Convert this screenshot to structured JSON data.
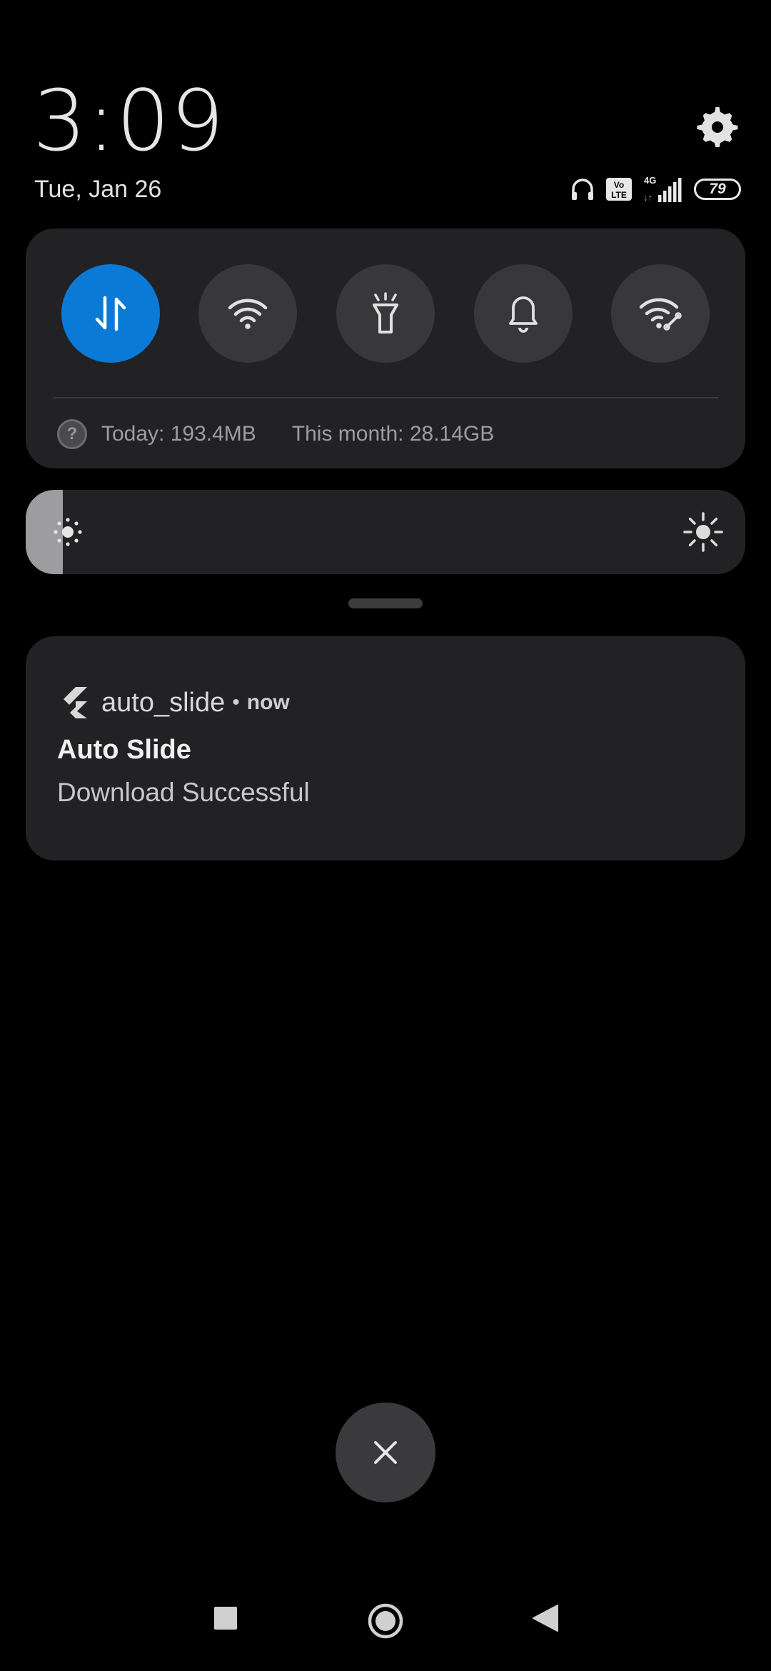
{
  "header": {
    "time": "3:09",
    "date": "Tue, Jan 26",
    "battery_level": "79",
    "network_label": "4G",
    "volte_label": "Vo LTE",
    "icons": [
      "headphones-icon",
      "volte-icon",
      "signal-4g-icon",
      "battery-icon",
      "settings-gear-icon"
    ]
  },
  "quick_settings": {
    "toggles": [
      {
        "name": "mobile-data",
        "icon": "mobile-data-arrows-icon",
        "active": true
      },
      {
        "name": "wifi",
        "icon": "wifi-icon",
        "active": false
      },
      {
        "name": "flashlight",
        "icon": "flashlight-icon",
        "active": false
      },
      {
        "name": "sound",
        "icon": "bell-icon",
        "active": false
      },
      {
        "name": "hotspot",
        "icon": "wifi-hotspot-icon",
        "active": false
      }
    ],
    "data_today": "Today: 193.4MB",
    "data_month": "This month: 28.14GB",
    "help_glyph": "?"
  },
  "brightness": {
    "level_fraction": 0.052
  },
  "notification": {
    "app_name": "auto_slide",
    "separator": "•",
    "time": "now",
    "title": "Auto Slide",
    "text": "Download Successful",
    "app_icon": "flutter-logo-icon"
  },
  "controls": {
    "clear_icon": "close-icon",
    "nav": [
      "recents-square-icon",
      "home-circle-icon",
      "back-triangle-icon"
    ]
  },
  "colors": {
    "accent": "#0b7ad6",
    "panel": "#222225",
    "toggle_inactive": "#38383b"
  }
}
